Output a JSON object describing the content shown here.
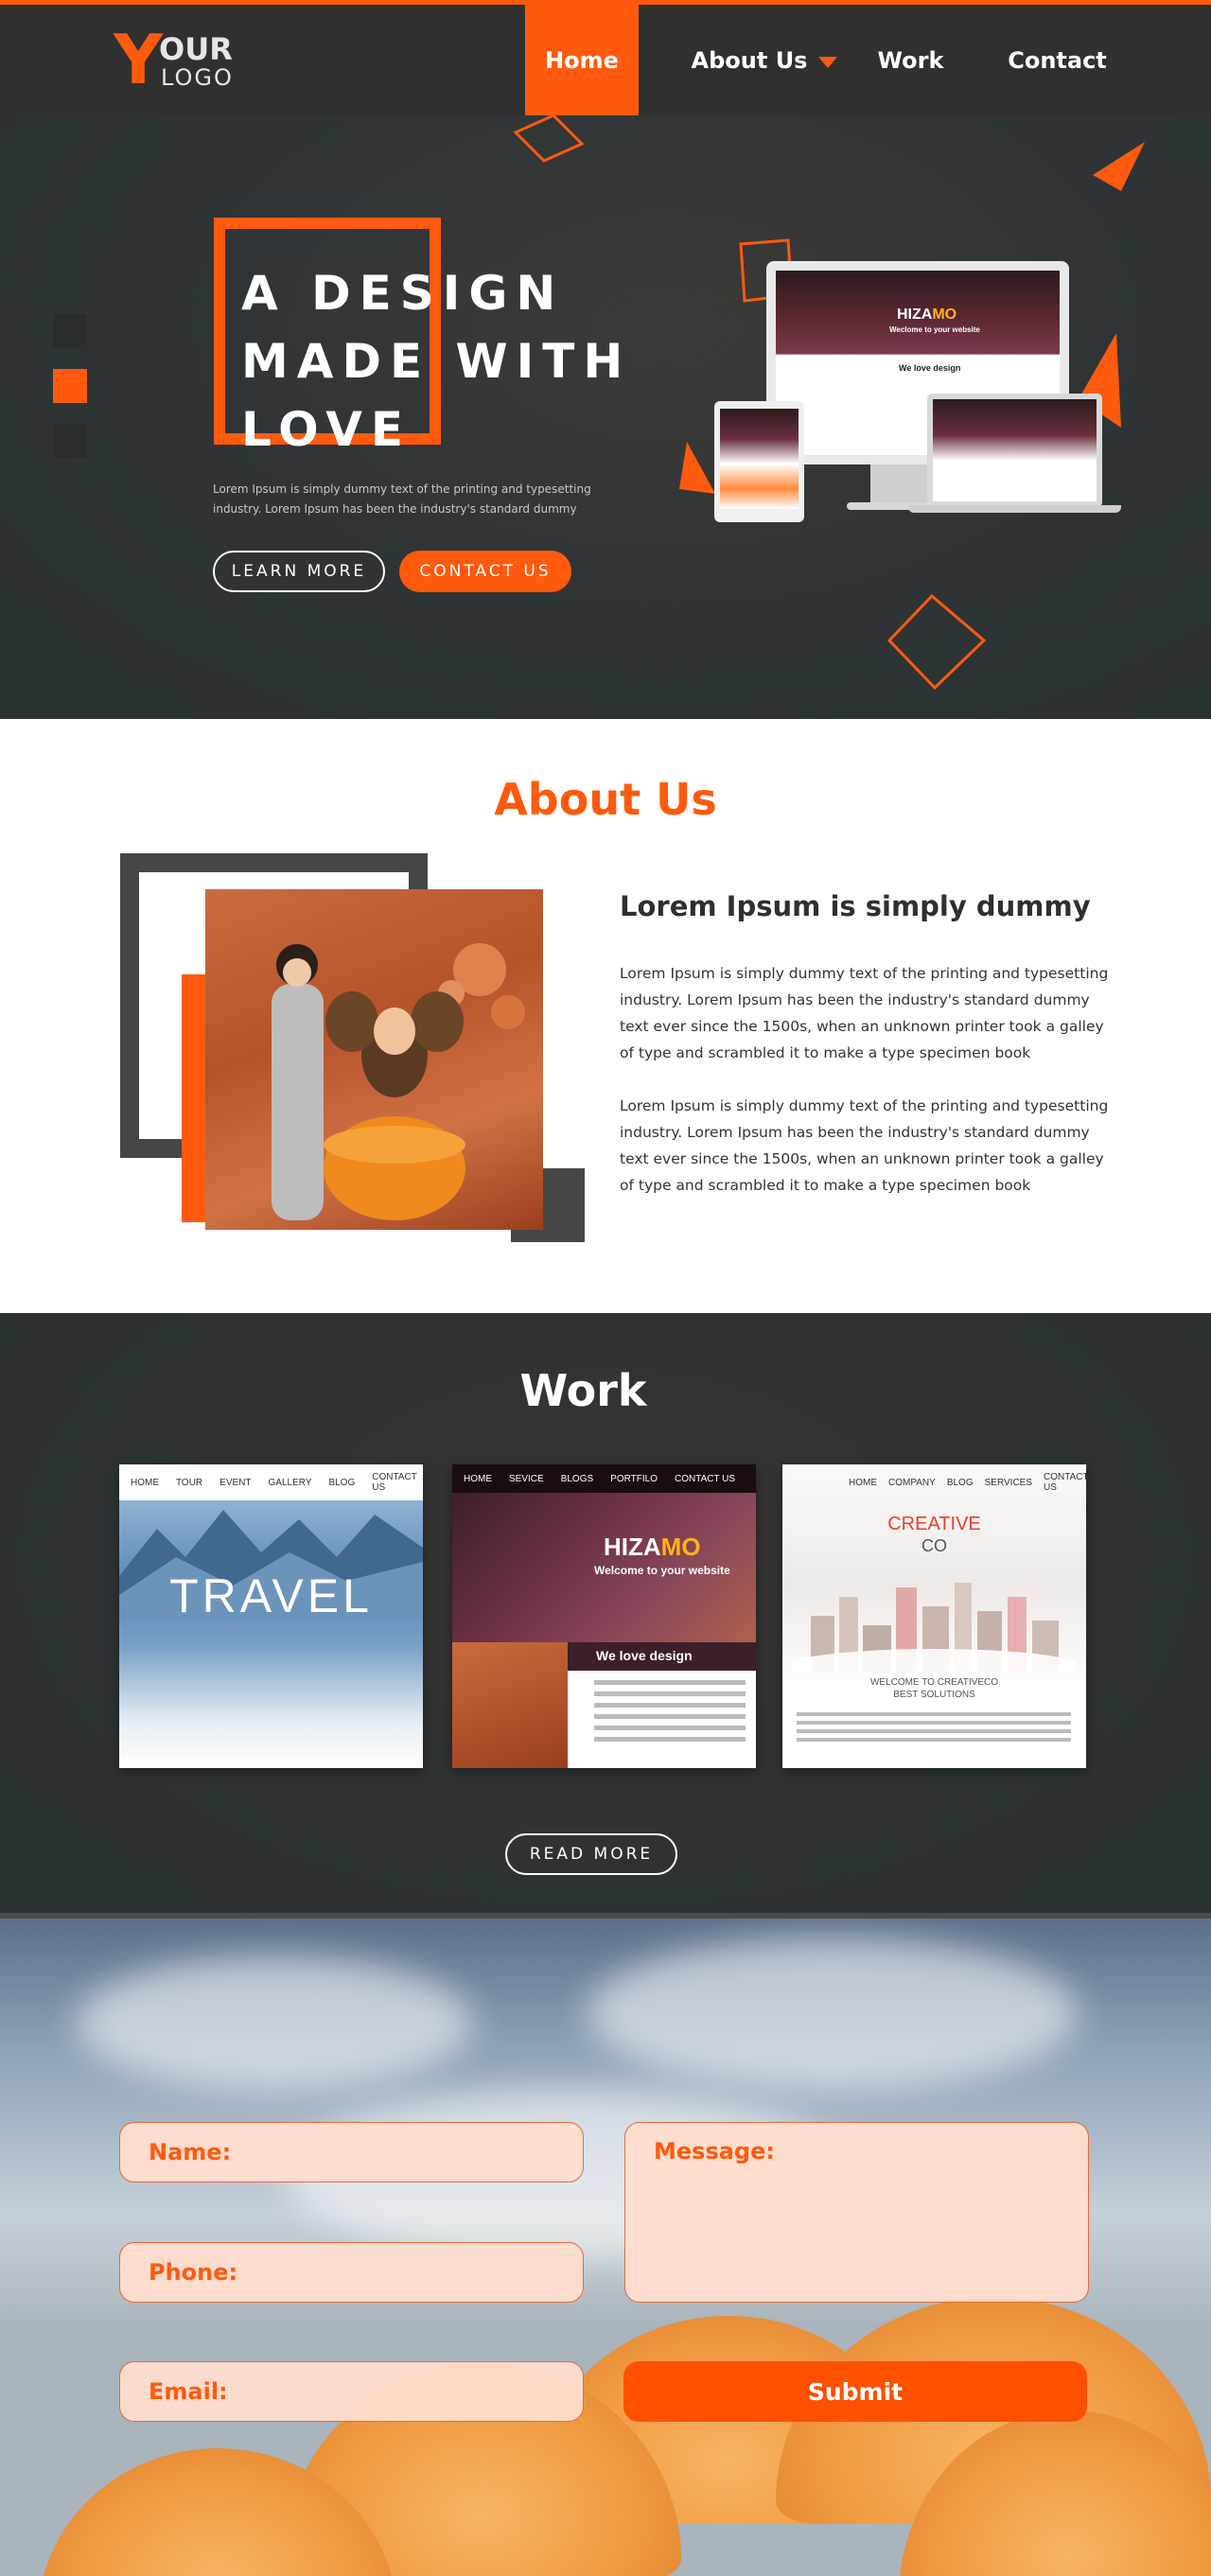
{
  "nav": {
    "logo_y": "Y",
    "logo_our": "OUR",
    "logo_logo": "LOGO",
    "items": [
      {
        "label": "Home"
      },
      {
        "label": "About Us"
      },
      {
        "label": "Work"
      },
      {
        "label": "Contact"
      }
    ]
  },
  "hero": {
    "title_lines": [
      "A DESIGN",
      "MADE WITH",
      "LOVE"
    ],
    "text": "Lorem Ipsum is simply dummy text of the printing and typesetting industry. Lorem Ipsum has been the industry's standard dummy",
    "learn_more": "LEARN MORE",
    "contact_us": "CONTACT US",
    "mockup_brand_a": "HIZA",
    "mockup_brand_b": "MO",
    "mockup_welcome": "Weclome to your website",
    "mockup_love": "We love design"
  },
  "about": {
    "title": "About Us",
    "heading": "Lorem Ipsum is simply dummy",
    "p1": "Lorem Ipsum is simply dummy text of the printing and typesetting industry. Lorem Ipsum has been the industry's standard dummy text ever since the 1500s, when an unknown printer took a galley of type and scrambled it to make a type specimen book",
    "p2": "Lorem Ipsum is simply dummy text of the printing and typesetting industry. Lorem Ipsum has been the industry's standard dummy text ever since the 1500s, when an unknown printer took a galley of type and scrambled it to make a type specimen book"
  },
  "work": {
    "title": "Work",
    "read_more": "READ MORE",
    "card1": {
      "nav": [
        "HOME",
        "TOUR",
        "EVENT",
        "GALLERY",
        "BLOG",
        "CONTACT US"
      ],
      "title": "TRAVEL"
    },
    "card2": {
      "nav": [
        "HOME",
        "SEVICE",
        "BLOGS",
        "PORTFILO",
        "CONTACT US"
      ],
      "brand_a": "HIZA",
      "brand_b": "MO",
      "welcome": "Welcome to your website",
      "love": "We love design"
    },
    "card3": {
      "nav": [
        "HOME",
        "COMPANY",
        "BLOG",
        "SERVICES",
        "CONTACT US"
      ],
      "brand": "CREATIVE",
      "co": "CO",
      "welcome": "WELCOME TO CREATIVECO",
      "sub": "BEST SOLUTIONS"
    }
  },
  "contact": {
    "name": "Name:",
    "phone": "Phone:",
    "email": "Email:",
    "message": "Message:",
    "submit": "Submit"
  },
  "colors": {
    "accent": "#ff5a0d",
    "dark": "#303030"
  }
}
